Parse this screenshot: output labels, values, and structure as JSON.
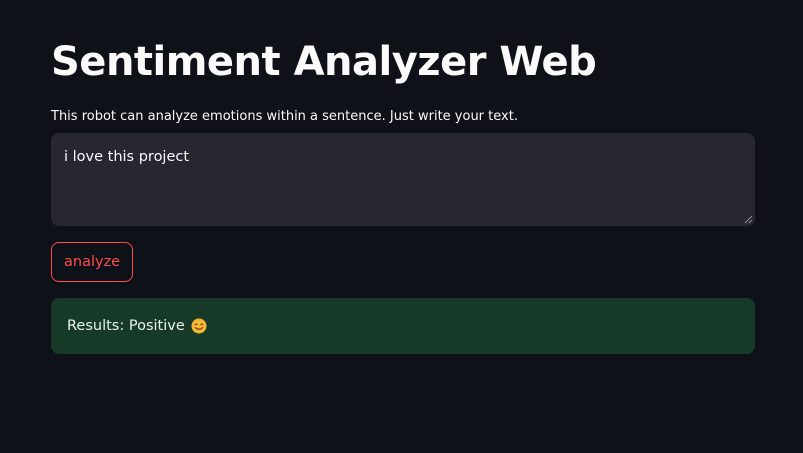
{
  "page": {
    "title": "Sentiment Analyzer Web",
    "description": "This robot can analyze emotions within a sentence. Just write your text."
  },
  "input": {
    "value": "i love this project"
  },
  "analyze_button": {
    "label": "analyze"
  },
  "result": {
    "text": "Results: Positive",
    "emoji_icon": "smiling-face-icon"
  },
  "colors": {
    "background": "#0e1117",
    "input_background": "#262730",
    "accent": "#ff4b4b",
    "success_background": "#173928"
  }
}
